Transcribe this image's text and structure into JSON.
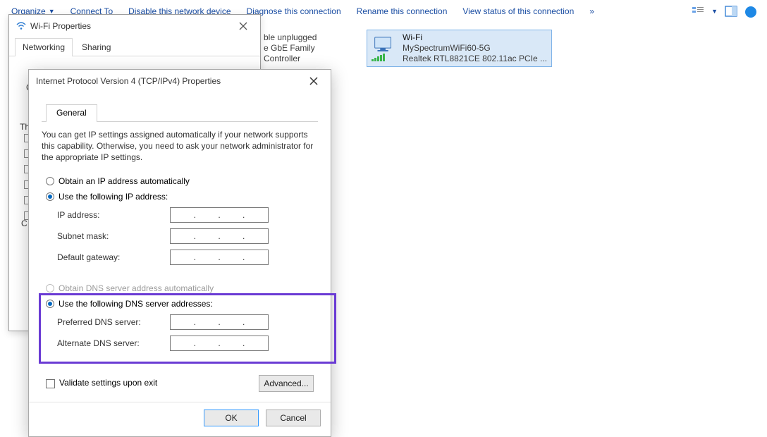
{
  "toolbar": {
    "items": [
      "Organize",
      "Connect To",
      "Disable this network device",
      "Diagnose this connection",
      "Rename this connection",
      "View status of this connection"
    ],
    "overflow": "»"
  },
  "bg": {
    "eth": {
      "line2": "ble unplugged",
      "line3": "e GbE Family Controller"
    },
    "wifi": {
      "title": "Wi-Fi",
      "ssid": "MySpectrumWiFi60-5G",
      "adapter": "Realtek RTL8821CE 802.11ac PCIe ..."
    }
  },
  "wifiDlg": {
    "title": "Wi-Fi Properties",
    "tabs": [
      "Networking",
      "Sharing"
    ],
    "bodyline1": "Co",
    "thLabel": "Th",
    "cLabel": "C"
  },
  "ipv4": {
    "title": "Internet Protocol Version 4 (TCP/IPv4) Properties",
    "tab": "General",
    "help": "You can get IP settings assigned automatically if your network supports this capability. Otherwise, you need to ask your network administrator for the appropriate IP settings.",
    "ip_auto": "Obtain an IP address automatically",
    "ip_manual": "Use the following IP address:",
    "ip_label": "IP address:",
    "subnet_label": "Subnet mask:",
    "gateway_label": "Default gateway:",
    "dns_auto": "Obtain DNS server address automatically",
    "dns_manual": "Use the following DNS server addresses:",
    "pref_dns": "Preferred DNS server:",
    "alt_dns": "Alternate DNS server:",
    "validate": "Validate settings upon exit",
    "advanced": "Advanced...",
    "ok": "OK",
    "cancel": "Cancel"
  }
}
